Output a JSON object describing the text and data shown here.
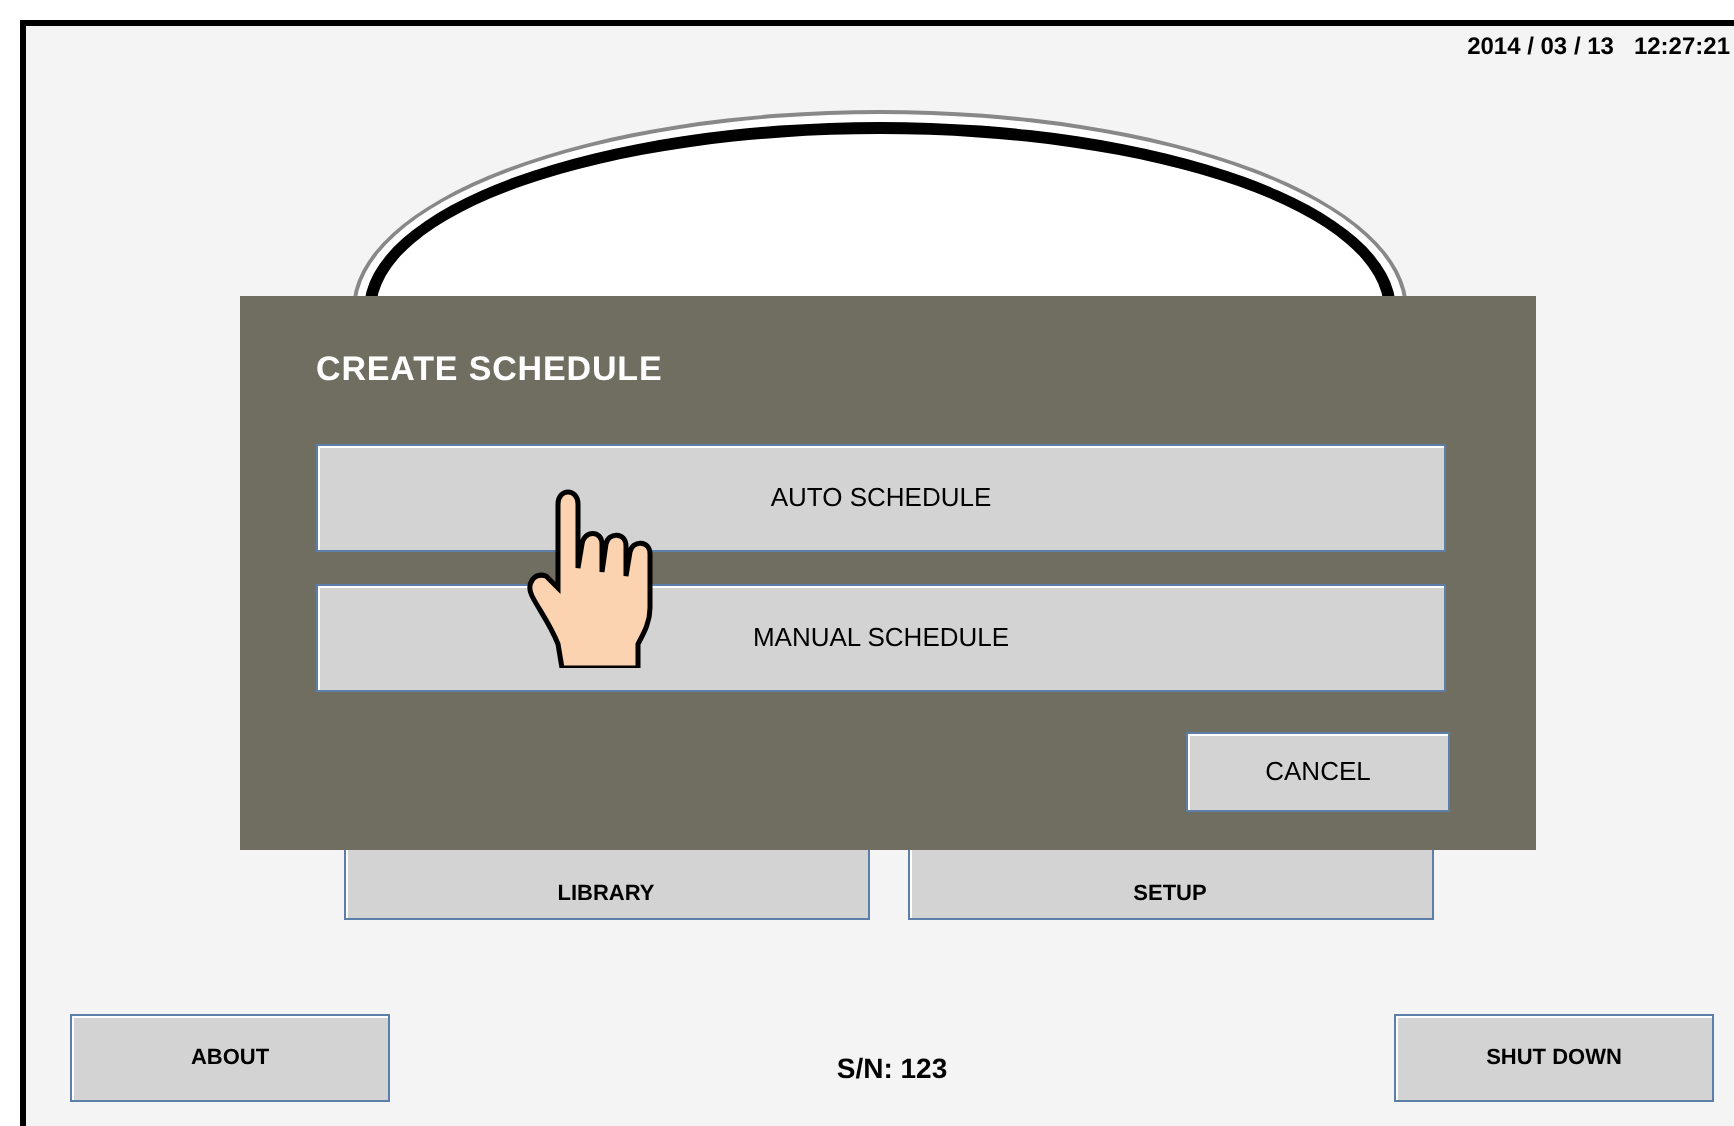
{
  "datetime": "2014 / 03 / 13   12:27:21",
  "main_buttons": [
    "LIBRARY",
    "SETUP"
  ],
  "footer": {
    "left_button": "ABOUT",
    "serial": "S/N: 123",
    "right_button": "SHUT DOWN"
  },
  "dialog": {
    "title": "CREATE SCHEDULE",
    "options": [
      "AUTO SCHEDULE",
      "MANUAL SCHEDULE"
    ],
    "cancel": "CANCEL"
  }
}
